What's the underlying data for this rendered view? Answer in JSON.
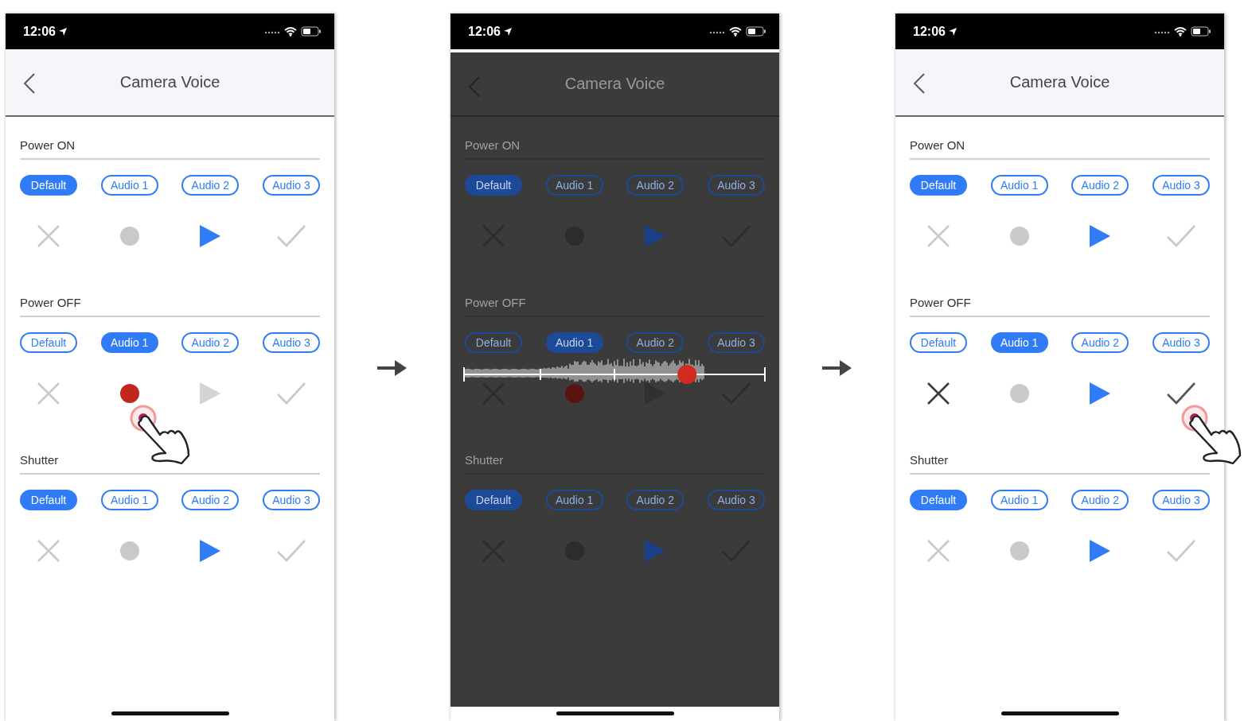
{
  "screens": [
    {
      "status_time": "12:06",
      "title": "Camera Voice",
      "dimmed": false,
      "sections": [
        {
          "title": "Power ON",
          "options": [
            {
              "label": "Default",
              "selected": true
            },
            {
              "label": "Audio 1",
              "selected": false
            },
            {
              "label": "Audio 2",
              "selected": false
            },
            {
              "label": "Audio 3",
              "selected": false
            }
          ],
          "actions": [
            {
              "kind": "cancel",
              "active": false,
              "tapped": false
            },
            {
              "kind": "record",
              "active": false,
              "tapped": false
            },
            {
              "kind": "play",
              "active": true,
              "tapped": false
            },
            {
              "kind": "confirm",
              "active": false,
              "tapped": false
            }
          ]
        },
        {
          "title": "Power OFF",
          "options": [
            {
              "label": "Default",
              "selected": false
            },
            {
              "label": "Audio 1",
              "selected": true
            },
            {
              "label": "Audio 2",
              "selected": false
            },
            {
              "label": "Audio 3",
              "selected": false
            }
          ],
          "actions": [
            {
              "kind": "cancel",
              "active": false,
              "tapped": false
            },
            {
              "kind": "record",
              "active": true,
              "tapped": true
            },
            {
              "kind": "play",
              "active": false,
              "tapped": false
            },
            {
              "kind": "confirm",
              "active": false,
              "tapped": false
            }
          ]
        },
        {
          "title": "Shutter",
          "options": [
            {
              "label": "Default",
              "selected": true
            },
            {
              "label": "Audio 1",
              "selected": false
            },
            {
              "label": "Audio 2",
              "selected": false
            },
            {
              "label": "Audio 3",
              "selected": false
            }
          ],
          "actions": [
            {
              "kind": "cancel",
              "active": false,
              "tapped": false
            },
            {
              "kind": "record",
              "active": false,
              "tapped": false
            },
            {
              "kind": "play",
              "active": true,
              "tapped": false
            },
            {
              "kind": "confirm",
              "active": false,
              "tapped": false
            }
          ]
        }
      ]
    },
    {
      "status_time": "12:06",
      "title": "Camera Voice",
      "dimmed": true,
      "recorder": {
        "level": 0.74
      },
      "sections": [
        {
          "title": "Power ON",
          "options": [
            {
              "label": "Default",
              "selected": true
            },
            {
              "label": "Audio 1",
              "selected": false
            },
            {
              "label": "Audio 2",
              "selected": false
            },
            {
              "label": "Audio 3",
              "selected": false
            }
          ],
          "actions": [
            {
              "kind": "cancel",
              "active": false,
              "tapped": false
            },
            {
              "kind": "record",
              "active": false,
              "tapped": false
            },
            {
              "kind": "play",
              "active": true,
              "tapped": false
            },
            {
              "kind": "confirm",
              "active": false,
              "tapped": false
            }
          ]
        },
        {
          "title": "Power OFF",
          "options": [
            {
              "label": "Default",
              "selected": false
            },
            {
              "label": "Audio 1",
              "selected": true
            },
            {
              "label": "Audio 2",
              "selected": false
            },
            {
              "label": "Audio 3",
              "selected": false
            }
          ],
          "actions": [
            {
              "kind": "cancel",
              "active": false,
              "tapped": false
            },
            {
              "kind": "record",
              "active": true,
              "tapped": false
            },
            {
              "kind": "play",
              "active": false,
              "tapped": false
            },
            {
              "kind": "confirm",
              "active": false,
              "tapped": false
            }
          ]
        },
        {
          "title": "Shutter",
          "options": [
            {
              "label": "Default",
              "selected": true
            },
            {
              "label": "Audio 1",
              "selected": false
            },
            {
              "label": "Audio 2",
              "selected": false
            },
            {
              "label": "Audio 3",
              "selected": false
            }
          ],
          "actions": [
            {
              "kind": "cancel",
              "active": false,
              "tapped": false
            },
            {
              "kind": "record",
              "active": false,
              "tapped": false
            },
            {
              "kind": "play",
              "active": true,
              "tapped": false
            },
            {
              "kind": "confirm",
              "active": false,
              "tapped": false
            }
          ]
        }
      ]
    },
    {
      "status_time": "12:06",
      "title": "Camera Voice",
      "dimmed": false,
      "sections": [
        {
          "title": "Power ON",
          "options": [
            {
              "label": "Default",
              "selected": true
            },
            {
              "label": "Audio 1",
              "selected": false
            },
            {
              "label": "Audio 2",
              "selected": false
            },
            {
              "label": "Audio 3",
              "selected": false
            }
          ],
          "actions": [
            {
              "kind": "cancel",
              "active": false,
              "tapped": false
            },
            {
              "kind": "record",
              "active": false,
              "tapped": false
            },
            {
              "kind": "play",
              "active": true,
              "tapped": false
            },
            {
              "kind": "confirm",
              "active": false,
              "tapped": false
            }
          ]
        },
        {
          "title": "Power OFF",
          "options": [
            {
              "label": "Default",
              "selected": false
            },
            {
              "label": "Audio 1",
              "selected": true
            },
            {
              "label": "Audio 2",
              "selected": false
            },
            {
              "label": "Audio 3",
              "selected": false
            }
          ],
          "actions": [
            {
              "kind": "cancel",
              "active": true,
              "tapped": false
            },
            {
              "kind": "record",
              "active": false,
              "tapped": false
            },
            {
              "kind": "play",
              "active": true,
              "tapped": false
            },
            {
              "kind": "confirm",
              "active": true,
              "tapped": true
            }
          ]
        },
        {
          "title": "Shutter",
          "options": [
            {
              "label": "Default",
              "selected": true
            },
            {
              "label": "Audio 1",
              "selected": false
            },
            {
              "label": "Audio 2",
              "selected": false
            },
            {
              "label": "Audio 3",
              "selected": false
            }
          ],
          "actions": [
            {
              "kind": "cancel",
              "active": false,
              "tapped": false
            },
            {
              "kind": "record",
              "active": false,
              "tapped": false
            },
            {
              "kind": "play",
              "active": true,
              "tapped": false
            },
            {
              "kind": "confirm",
              "active": false,
              "tapped": false
            }
          ]
        }
      ]
    }
  ]
}
